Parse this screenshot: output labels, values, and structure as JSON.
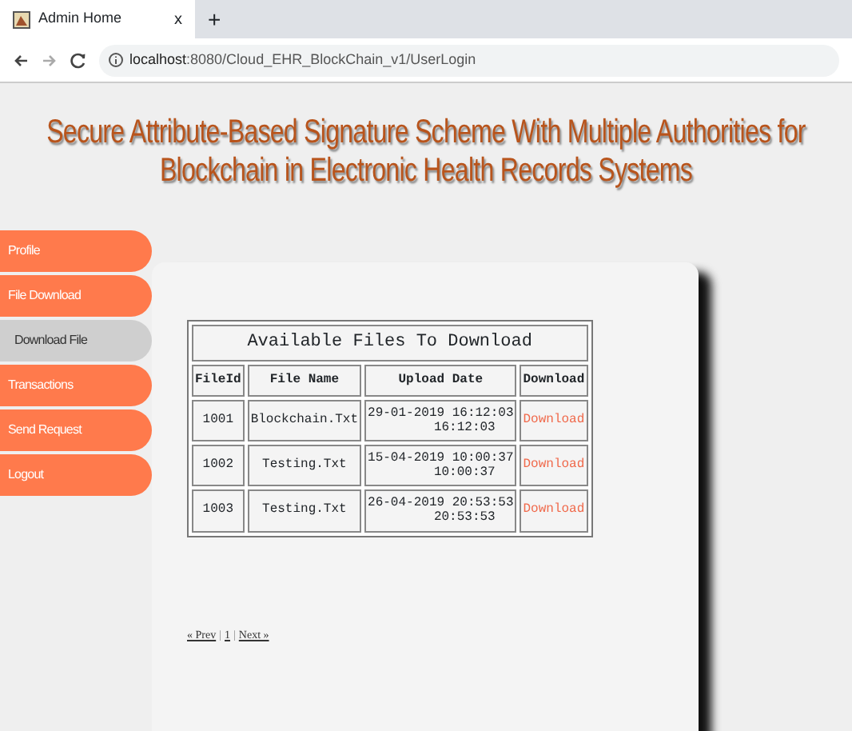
{
  "browser": {
    "tab_title": "Admin Home",
    "tab_close": "x",
    "new_tab": "+",
    "url_host": "localhost",
    "url_rest": ":8080/Cloud_EHR_BlockChain_v1/UserLogin"
  },
  "title_lines": [
    "Secure Attribute-Based Signature Scheme With Multiple Authorities for",
    "Blockchain in Electronic Health Records Systems"
  ],
  "sidebar": {
    "items": [
      {
        "label": "Profile",
        "selected": false
      },
      {
        "label": "File Download",
        "selected": false
      },
      {
        "label": "Download File",
        "selected": true
      },
      {
        "label": "Transactions",
        "selected": false
      },
      {
        "label": "Send Request",
        "selected": false
      },
      {
        "label": "Logout",
        "selected": false
      }
    ]
  },
  "table": {
    "caption": "Available Files To Download",
    "columns": [
      "FileId",
      "File Name",
      "Upload Date",
      "Download"
    ],
    "rows": [
      {
        "file_id": "1001",
        "file_name": "Blockchain.Txt",
        "upload_date": "29-01-2019 16:12:03",
        "upload_time": "16:12:03",
        "download": "Download"
      },
      {
        "file_id": "1002",
        "file_name": "Testing.Txt",
        "upload_date": "15-04-2019 10:00:37",
        "upload_time": "10:00:37",
        "download": "Download"
      },
      {
        "file_id": "1003",
        "file_name": "Testing.Txt",
        "upload_date": "26-04-2019 20:53:53",
        "upload_time": "20:53:53",
        "download": "Download"
      }
    ]
  },
  "pagination": [
    {
      "kind": "link",
      "text": "« Prev"
    },
    {
      "kind": "separator",
      "text": "|"
    },
    {
      "kind": "link",
      "text": "1"
    },
    {
      "kind": "separator",
      "text": "|"
    },
    {
      "kind": "link",
      "text": "Next »"
    }
  ]
}
